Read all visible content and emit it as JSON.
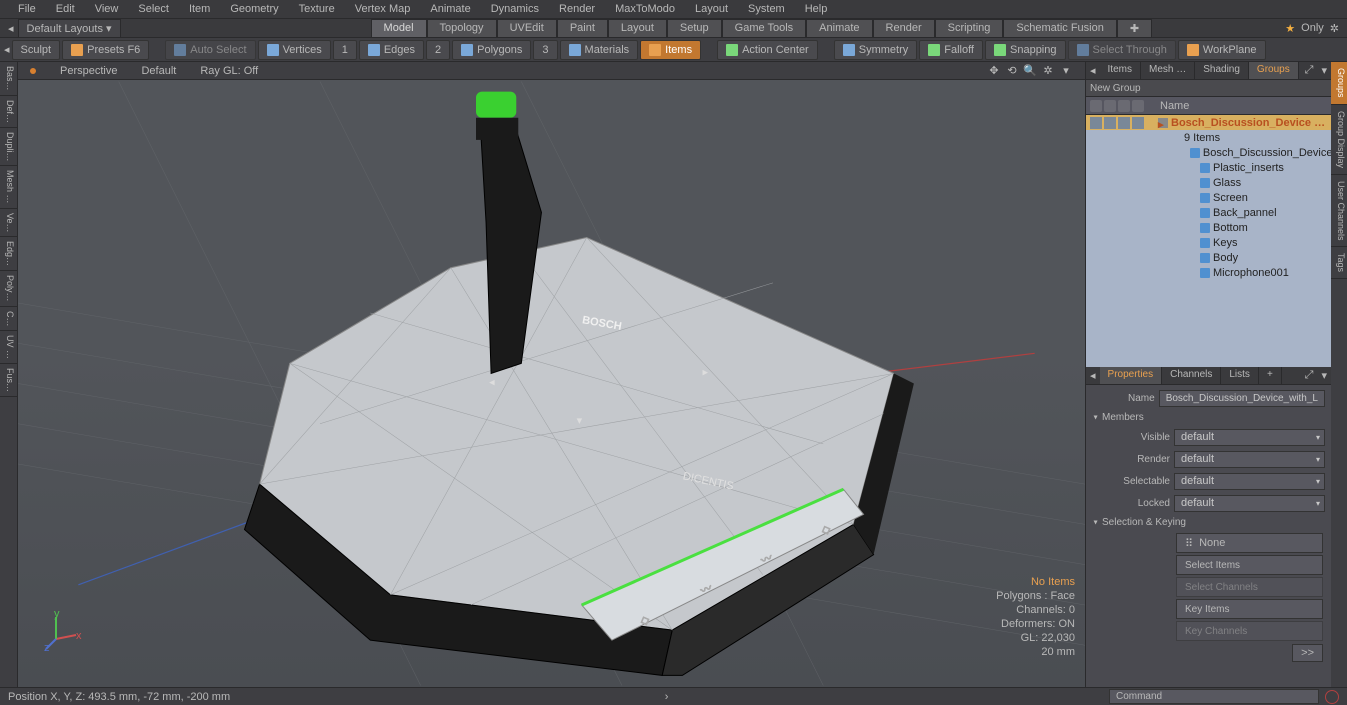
{
  "menu": [
    "File",
    "Edit",
    "View",
    "Select",
    "Item",
    "Geometry",
    "Texture",
    "Vertex Map",
    "Animate",
    "Dynamics",
    "Render",
    "MaxToModo",
    "Layout",
    "System",
    "Help"
  ],
  "layout_dropdown": "Default Layouts ▾",
  "layout_tabs": [
    "Model",
    "Topology",
    "UVEdit",
    "Paint",
    "Layout",
    "Setup",
    "Game Tools",
    "Animate",
    "Render",
    "Scripting",
    "Schematic Fusion"
  ],
  "layout_active": 0,
  "only_label": "Only",
  "tools": {
    "sculpt": "Sculpt",
    "presets": "Presets  F6",
    "auto_select": "Auto Select",
    "vertices": "Vertices",
    "num1": "1",
    "edges": "Edges",
    "num2": "2",
    "polygons": "Polygons",
    "num3": "3",
    "materials": "Materials",
    "items": "Items",
    "action_center": "Action Center",
    "symmetry": "Symmetry",
    "falloff": "Falloff",
    "snapping": "Snapping",
    "select_through": "Select Through",
    "workplane": "WorkPlane"
  },
  "left_tabs": [
    "Bas…",
    "Def…",
    "Dupli…",
    "Mesh …",
    "Ve…",
    "Edg…",
    "Poly…",
    "C…",
    "UV …",
    "Fus…"
  ],
  "viewport": {
    "mode": "Perspective",
    "shading": "Default",
    "raygl": "Ray GL: Off",
    "stats": {
      "no_items": "No Items",
      "polys": "Polygons : Face",
      "channels": "Channels: 0",
      "deformers": "Deformers: ON",
      "gl": "GL: 22,030",
      "grid": "20 mm"
    },
    "model_brand": "BOSCH",
    "model_line": "DICENTIS"
  },
  "item_panel": {
    "tabs": [
      "Items",
      "Mesh …",
      "Shading",
      "Groups"
    ],
    "active": 3,
    "new_group": "New Group",
    "name_col": "Name",
    "tree": [
      {
        "label": "Bosch_Discussion_Device …",
        "indent": 0,
        "icon": "grp",
        "selected": true,
        "eyes": true
      },
      {
        "label": "9 Items",
        "indent": 1,
        "icon": "",
        "eyes": false
      },
      {
        "label": "Bosch_Discussion_Device_w…",
        "indent": 2,
        "icon": "mesh",
        "eyes": false
      },
      {
        "label": "Plastic_inserts",
        "indent": 2,
        "icon": "mesh",
        "eyes": false
      },
      {
        "label": "Glass",
        "indent": 2,
        "icon": "mesh",
        "eyes": false
      },
      {
        "label": "Screen",
        "indent": 2,
        "icon": "mesh",
        "eyes": false
      },
      {
        "label": "Back_pannel",
        "indent": 2,
        "icon": "mesh",
        "eyes": false
      },
      {
        "label": "Bottom",
        "indent": 2,
        "icon": "mesh",
        "eyes": false
      },
      {
        "label": "Keys",
        "indent": 2,
        "icon": "mesh",
        "eyes": false
      },
      {
        "label": "Body",
        "indent": 2,
        "icon": "mesh",
        "eyes": false
      },
      {
        "label": "Microphone001",
        "indent": 2,
        "icon": "mesh",
        "eyes": false
      }
    ]
  },
  "props": {
    "tabs": [
      "Properties",
      "Channels",
      "Lists",
      "+"
    ],
    "active": 0,
    "name_label": "Name",
    "name_value": "Bosch_Discussion_Device_with_L",
    "members_section": "Members",
    "fields": [
      {
        "label": "Visible",
        "value": "default"
      },
      {
        "label": "Render",
        "value": "default"
      },
      {
        "label": "Selectable",
        "value": "default"
      },
      {
        "label": "Locked",
        "value": "default"
      }
    ],
    "sel_section": "Selection & Keying",
    "none_btn": "None",
    "buttons": [
      "Select Items",
      "Select Channels",
      "Key Items",
      "Key Channels"
    ],
    "arrow": ">>"
  },
  "right_strip": [
    "Groups",
    "Group Display",
    "User Channels",
    "Tags"
  ],
  "status": {
    "pos": "Position X, Y, Z:   493.5 mm, -72 mm, -200 mm",
    "cmd": "Command"
  }
}
